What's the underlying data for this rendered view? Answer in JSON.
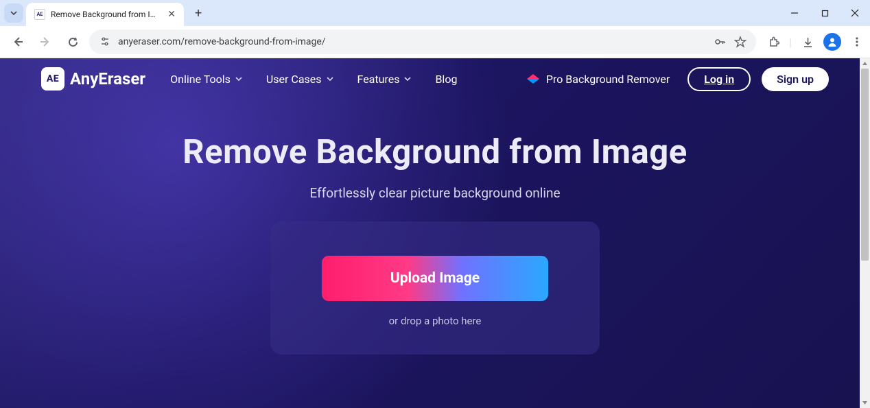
{
  "chrome": {
    "tab_title": "Remove Background from Imag",
    "url": "anyeraser.com/remove-background-from-image/",
    "favicon_text": "AE"
  },
  "site": {
    "logo_badge": "AE",
    "logo_text": "AnyEraser",
    "nav": [
      {
        "label": "Online Tools"
      },
      {
        "label": "User Cases"
      },
      {
        "label": "Features"
      },
      {
        "label": "Blog"
      }
    ],
    "pro_label": "Pro Background Remover",
    "login_label": "Log in",
    "signup_label": "Sign up"
  },
  "hero": {
    "title": "Remove Background from Image",
    "subtitle": "Effortlessly clear picture background online",
    "upload_button": "Upload Image",
    "drop_hint": "or drop a photo here"
  }
}
